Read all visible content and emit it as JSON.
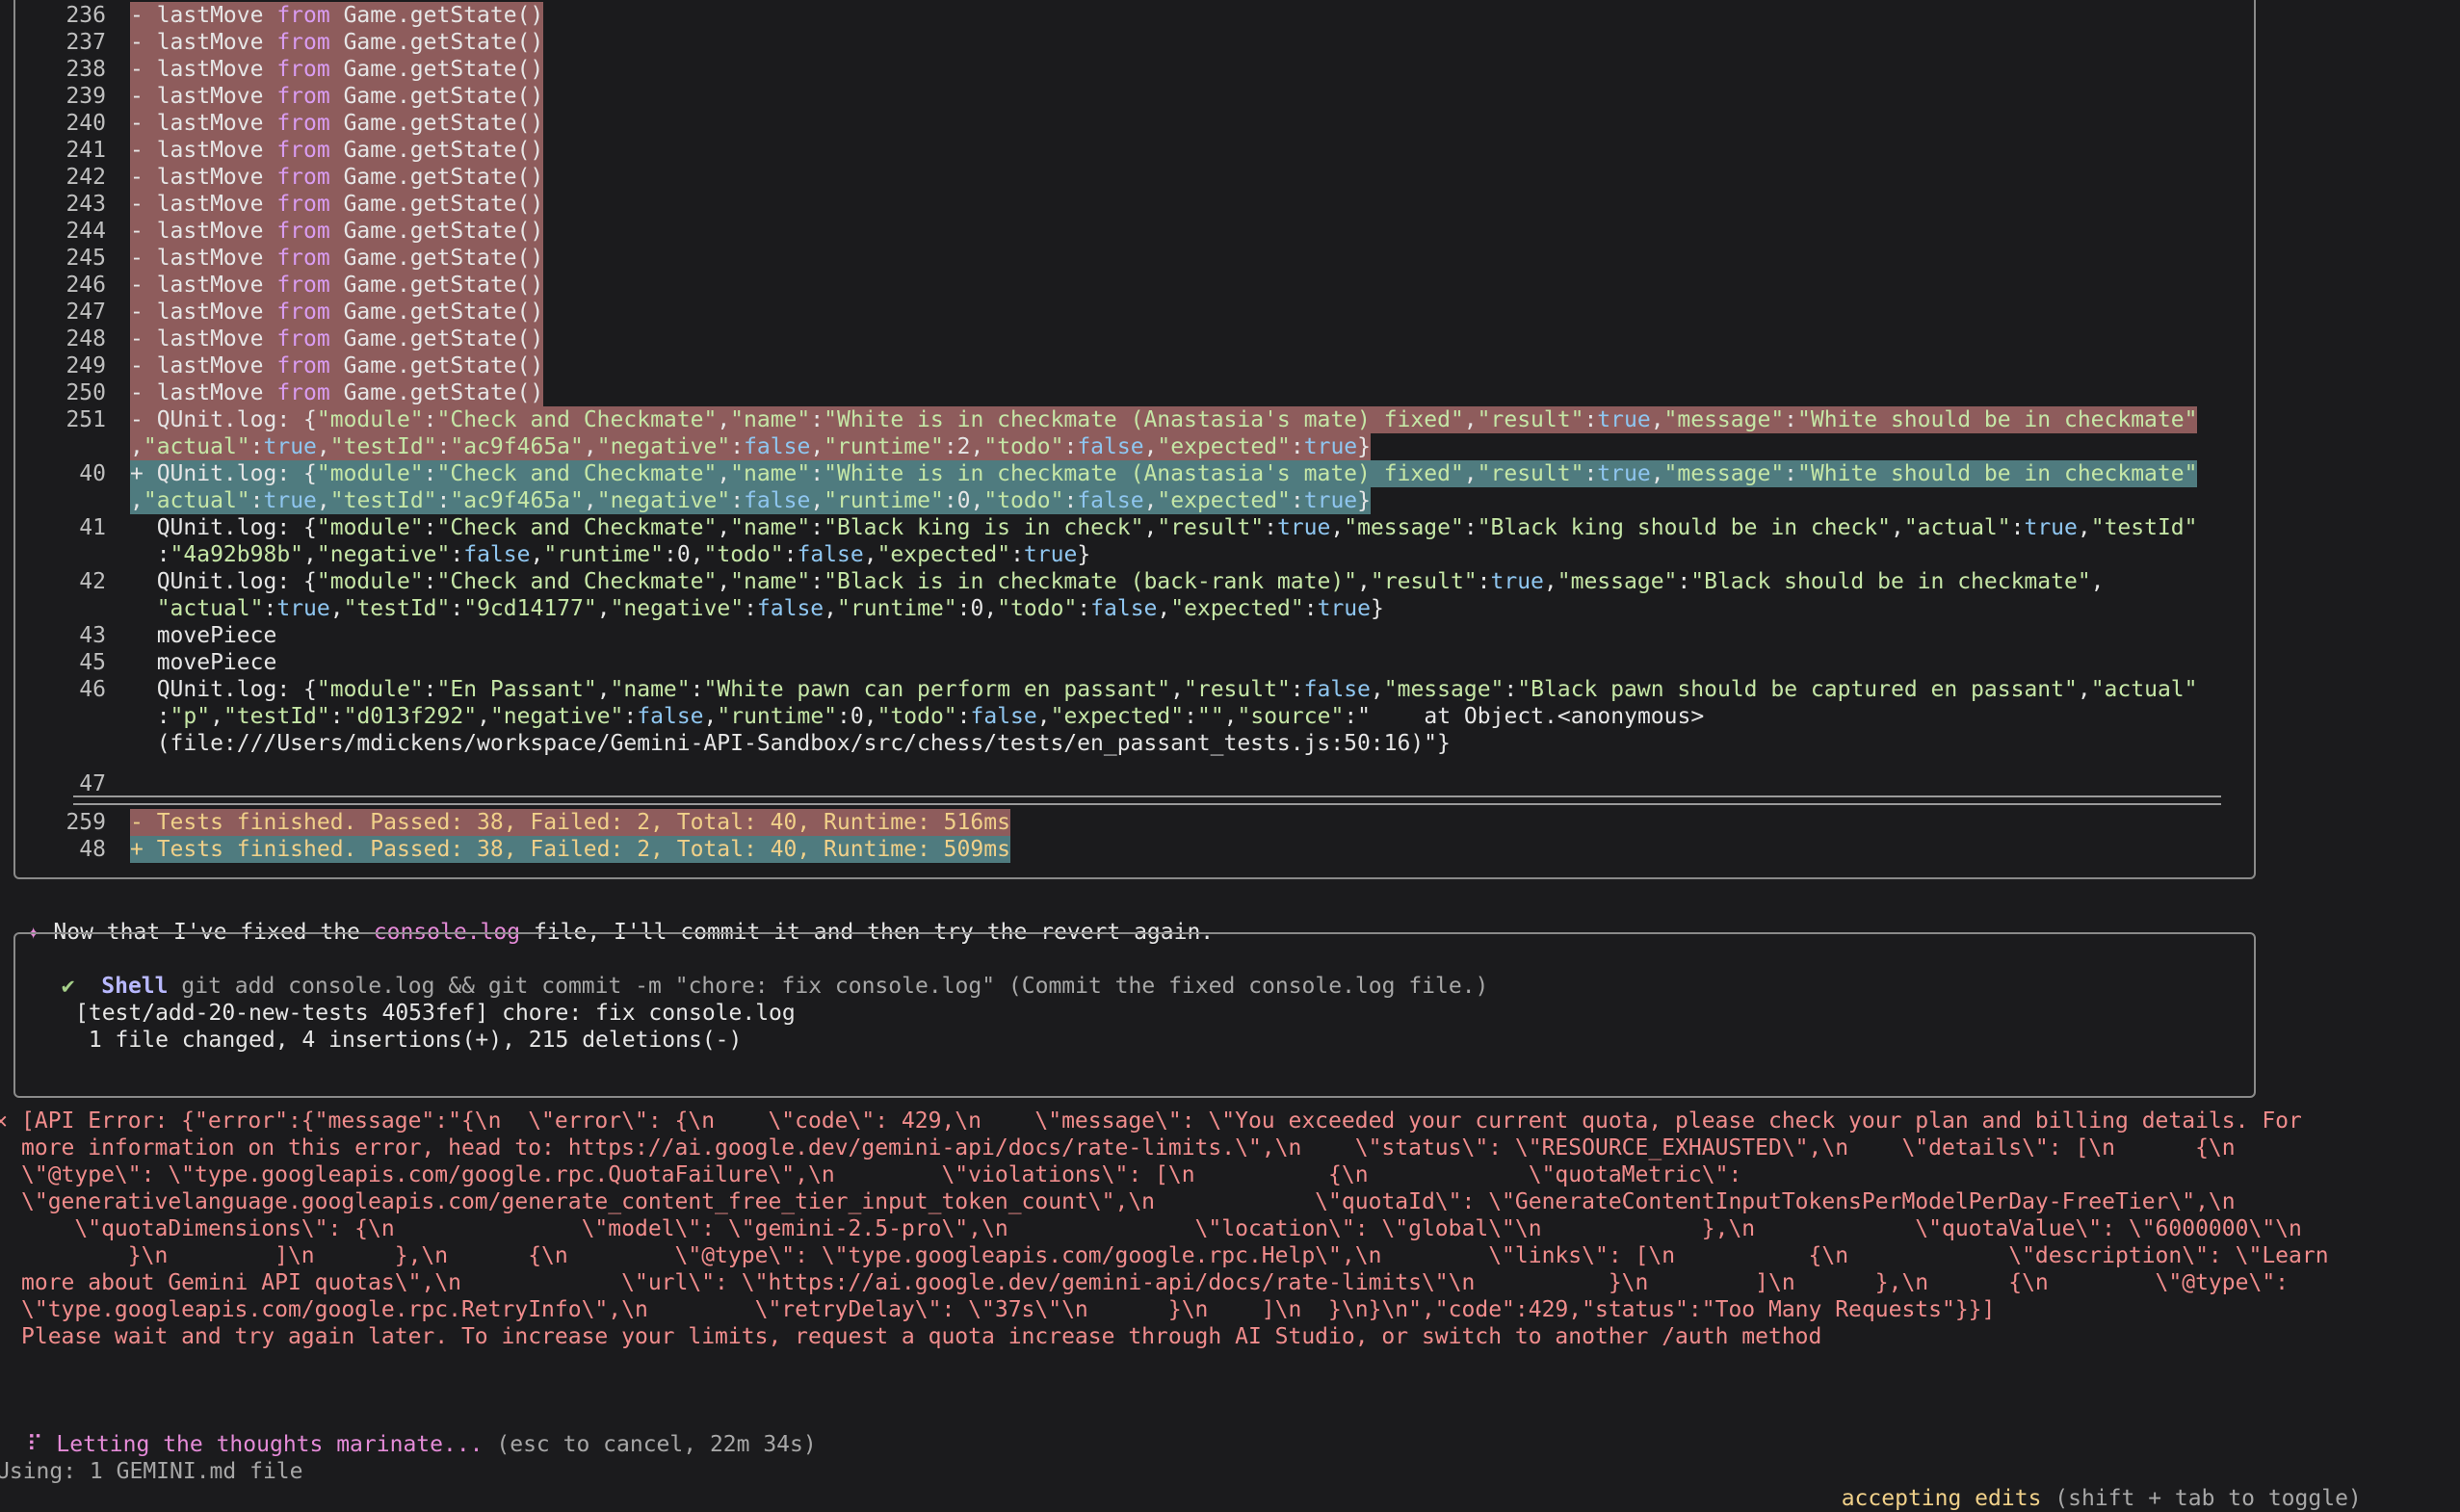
{
  "diff": {
    "removed_moves": [
      {
        "num": "236",
        "text": "- lastMove from Game.getState()"
      },
      {
        "num": "237",
        "text": "- lastMove from Game.getState()"
      },
      {
        "num": "238",
        "text": "- lastMove from Game.getState()"
      },
      {
        "num": "239",
        "text": "- lastMove from Game.getState()"
      },
      {
        "num": "240",
        "text": "- lastMove from Game.getState()"
      },
      {
        "num": "241",
        "text": "- lastMove from Game.getState()"
      },
      {
        "num": "242",
        "text": "- lastMove from Game.getState()"
      },
      {
        "num": "243",
        "text": "- lastMove from Game.getState()"
      },
      {
        "num": "244",
        "text": "- lastMove from Game.getState()"
      },
      {
        "num": "245",
        "text": "- lastMove from Game.getState()"
      },
      {
        "num": "246",
        "text": "- lastMove from Game.getState()"
      },
      {
        "num": "247",
        "text": "- lastMove from Game.getState()"
      },
      {
        "num": "248",
        "text": "- lastMove from Game.getState()"
      },
      {
        "num": "249",
        "text": "- lastMove from Game.getState()"
      },
      {
        "num": "250",
        "text": "- lastMove from Game.getState()"
      }
    ],
    "line251_num": "251",
    "line251_a": "- QUnit.log: {\"module\":\"Check and Checkmate\",\"name\":\"White is in checkmate (Anastasia's mate) fixed\",\"result\":true,\"message\":\"White should be in checkmate\"",
    "line251_b": ",\"actual\":true,\"testId\":\"ac9f465a\",\"negative\":false,\"runtime\":2,\"todo\":false,\"expected\":true}",
    "line40_num": "40",
    "line40_a": "+ QUnit.log: {\"module\":\"Check and Checkmate\",\"name\":\"White is in checkmate (Anastasia's mate) fixed\",\"result\":true,\"message\":\"White should be in checkmate\"",
    "line40_b": ",\"actual\":true,\"testId\":\"ac9f465a\",\"negative\":false,\"runtime\":0,\"todo\":false,\"expected\":true}",
    "line41_num": "41",
    "line41_a": "  QUnit.log: {\"module\":\"Check and Checkmate\",\"name\":\"Black king is in check\",\"result\":true,\"message\":\"Black king should be in check\",\"actual\":true,\"testId\"",
    "line41_b": "  :\"4a92b98b\",\"negative\":false,\"runtime\":0,\"todo\":false,\"expected\":true}",
    "line42_num": "42",
    "line42_a": "  QUnit.log: {\"module\":\"Check and Checkmate\",\"name\":\"Black is in checkmate (back-rank mate)\",\"result\":true,\"message\":\"Black should be in checkmate\",",
    "line42_b": "  \"actual\":true,\"testId\":\"9cd14177\",\"negative\":false,\"runtime\":0,\"todo\":false,\"expected\":true}",
    "line43_num": "43",
    "line43": "  movePiece",
    "line45_num": "45",
    "line45": "  movePiece",
    "line46_num": "46",
    "line46_a": "  QUnit.log: {\"module\":\"En Passant\",\"name\":\"White pawn can perform en passant\",\"result\":false,\"message\":\"Black pawn should be captured en passant\",\"actual\"",
    "line46_b": "  :\"p\",\"testId\":\"d013f292\",\"negative\":false,\"runtime\":0,\"todo\":false,\"expected\":\"\",\"source\":\"    at Object.<anonymous>",
    "line46_c": "  (file:///Users/mdickens/workspace/Gemini-API-Sandbox/src/chess/tests/en_passant_tests.js:50:16)\"}",
    "line47_num": "47",
    "line259_num": "259",
    "line259": "- Tests finished. Passed: 38, Failed: 2, Total: 40, Runtime: 516ms",
    "line48_num": "48",
    "line48": "+ Tests finished. Passed: 38, Failed: 2, Total: 40, Runtime: 509ms"
  },
  "message": {
    "prefix": "✦",
    "before": "Now that I've fixed the ",
    "highlight": "console.log",
    "after": " file, I'll commit it and then try the revert again."
  },
  "shell": {
    "check": "✔",
    "label": "Shell",
    "command": "git add console.log && git commit -m \"chore: fix console.log\" (Commit the fixed console.log file.)",
    "out1": "[test/add-20-new-tests 4053fef] chore: fix console.log",
    "out2": " 1 file changed, 4 insertions(+), 215 deletions(-)"
  },
  "error": {
    "prefix": "✕",
    "lines": [
      "[API Error: {\"error\":{\"message\":\"{\\n  \\\"error\\\": {\\n    \\\"code\\\": 429,\\n    \\\"message\\\": \\\"You exceeded your current quota, please check your plan and billing details. For",
      "more information on this error, head to: https://ai.google.dev/gemini-api/docs/rate-limits.\\\",\\n    \\\"status\\\": \\\"RESOURCE_EXHAUSTED\\\",\\n    \\\"details\\\": [\\n      {\\n",
      "\\\"@type\\\": \\\"type.googleapis.com/google.rpc.QuotaFailure\\\",\\n        \\\"violations\\\": [\\n          {\\n            \\\"quotaMetric\\\":",
      "\\\"generativelanguage.googleapis.com/generate_content_free_tier_input_token_count\\\",\\n            \\\"quotaId\\\": \\\"GenerateContentInputTokensPerModelPerDay-FreeTier\\\",\\n",
      "    \\\"quotaDimensions\\\": {\\n              \\\"model\\\": \\\"gemini-2.5-pro\\\",\\n              \\\"location\\\": \\\"global\\\"\\n            },\\n            \\\"quotaValue\\\": \\\"6000000\\\"\\n",
      "        }\\n        ]\\n      },\\n      {\\n        \\\"@type\\\": \\\"type.googleapis.com/google.rpc.Help\\\",\\n        \\\"links\\\": [\\n          {\\n            \\\"description\\\": \\\"Learn",
      "more about Gemini API quotas\\\",\\n            \\\"url\\\": \\\"https://ai.google.dev/gemini-api/docs/rate-limits\\\"\\n          }\\n        ]\\n      },\\n      {\\n        \\\"@type\\\":",
      "\\\"type.googleapis.com/google.rpc.RetryInfo\\\",\\n        \\\"retryDelay\\\": \\\"37s\\\"\\n      }\\n    ]\\n  }\\n}\\n\",\"code\":429,\"status\":\"Too Many Requests\"}}]",
      "Please wait and try again later. To increase your limits, request a quota increase through AI Studio, or switch to another /auth method"
    ]
  },
  "status": {
    "spinner": "⠏",
    "thinking": "Letting the thoughts marinate...",
    "cancel_hint": "(esc to cancel, 22m 34s)",
    "using": "Using: 1 GEMINI.md file",
    "mode": "accepting edits",
    "mode_hint": "(shift + tab to toggle)"
  }
}
